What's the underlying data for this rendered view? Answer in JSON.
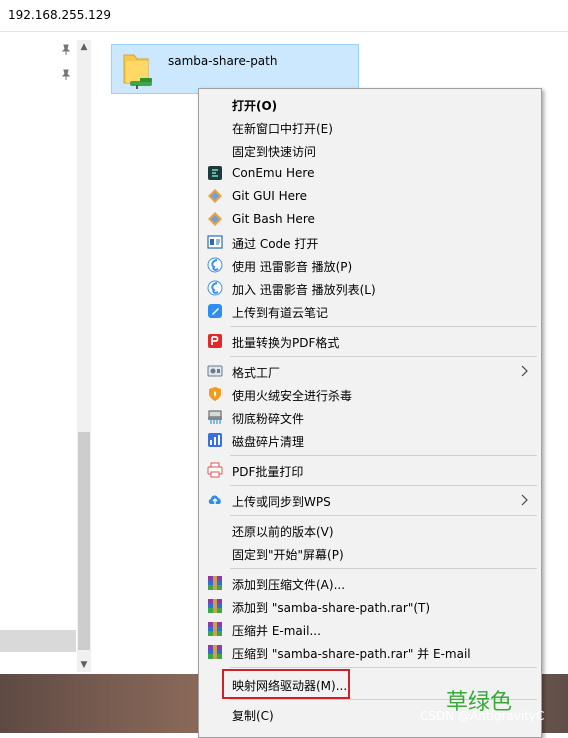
{
  "address": {
    "path": "192.168.255.129"
  },
  "folder": {
    "name": "samba-share-path"
  },
  "context_menu": {
    "items": [
      {
        "label": "打开(O)",
        "icon": "none",
        "bold": true,
        "submenu": false
      },
      {
        "label": "在新窗口中打开(E)",
        "icon": "none",
        "bold": false,
        "submenu": false
      },
      {
        "label": "固定到快速访问",
        "icon": "none",
        "bold": false,
        "submenu": false
      },
      {
        "label": "ConEmu Here",
        "icon": "conemu-icon",
        "bold": false,
        "submenu": false
      },
      {
        "label": "Git GUI Here",
        "icon": "git-gui-icon",
        "bold": false,
        "submenu": false
      },
      {
        "label": "Git Bash Here",
        "icon": "git-bash-icon",
        "bold": false,
        "submenu": false
      },
      {
        "label": "通过 Code 打开",
        "icon": "vscode-icon",
        "bold": false,
        "submenu": false
      },
      {
        "label": "使用 迅雷影音 播放(P)",
        "icon": "xunlei-player-icon",
        "bold": false,
        "submenu": false
      },
      {
        "label": "加入 迅雷影音 播放列表(L)",
        "icon": "xunlei-playlist-icon",
        "bold": false,
        "submenu": false
      },
      {
        "label": "上传到有道云笔记",
        "icon": "youdao-note-icon",
        "bold": false,
        "submenu": false
      },
      {
        "label": "批量转换为PDF格式",
        "icon": "pdf-convert-icon",
        "bold": false,
        "submenu": false
      },
      {
        "label": "格式工厂",
        "icon": "format-factory-icon",
        "bold": false,
        "submenu": true
      },
      {
        "label": "使用火绒安全进行杀毒",
        "icon": "huorong-shield-icon",
        "bold": false,
        "submenu": false
      },
      {
        "label": "彻底粉碎文件",
        "icon": "shredder-icon",
        "bold": false,
        "submenu": false
      },
      {
        "label": "磁盘碎片清理",
        "icon": "disk-defrag-icon",
        "bold": false,
        "submenu": false
      },
      {
        "label": "PDF批量打印",
        "icon": "printer-icon",
        "bold": false,
        "submenu": false
      },
      {
        "label": "上传或同步到WPS",
        "icon": "cloud-upload-icon",
        "bold": false,
        "submenu": true
      },
      {
        "label": "还原以前的版本(V)",
        "icon": "none",
        "bold": false,
        "submenu": false
      },
      {
        "label": "固定到\"开始\"屏幕(P)",
        "icon": "none",
        "bold": false,
        "submenu": false
      },
      {
        "label": "添加到压缩文件(A)...",
        "icon": "winrar-icon",
        "bold": false,
        "submenu": false
      },
      {
        "label": "添加到 \"samba-share-path.rar\"(T)",
        "icon": "winrar-icon",
        "bold": false,
        "submenu": false
      },
      {
        "label": "压缩并 E-mail...",
        "icon": "winrar-icon",
        "bold": false,
        "submenu": false
      },
      {
        "label": "压缩到 \"samba-share-path.rar\" 并 E-mail",
        "icon": "winrar-icon",
        "bold": false,
        "submenu": false
      },
      {
        "label": "映射网络驱动器(M)...",
        "icon": "none",
        "bold": false,
        "submenu": false
      },
      {
        "label": "复制(C)",
        "icon": "none",
        "bold": false,
        "submenu": false
      }
    ]
  },
  "watermark": {
    "green_text": "草绿色",
    "csdn_text": "CSDN @AntigravityC"
  },
  "colors": {
    "selection": "#cce8ff",
    "highlight_box": "#d0202a",
    "menu_bg": "#f2f2f2"
  }
}
